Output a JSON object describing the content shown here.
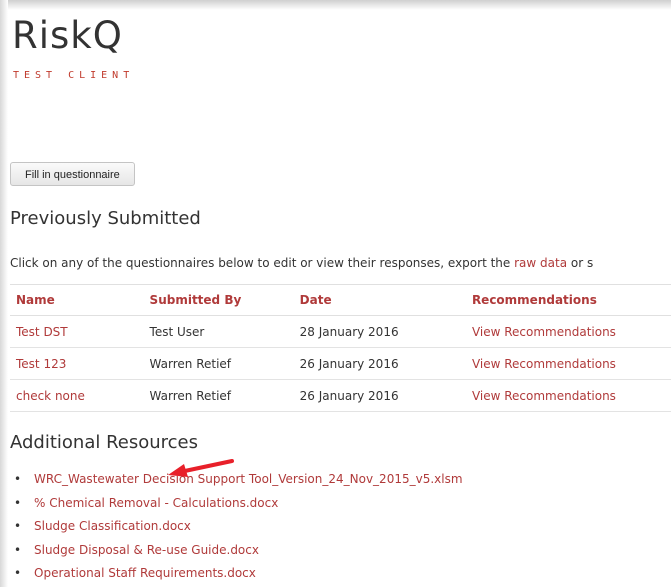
{
  "app": {
    "brand": "RiskQ",
    "client": "TEST CLIENT"
  },
  "actions": {
    "fill_button": "Fill in questionnaire"
  },
  "previous": {
    "heading": "Previously Submitted",
    "intro_prefix": "Click on any of the questionnaires below to edit or view their responses, export the ",
    "intro_link": "raw data",
    "intro_suffix": " or s",
    "columns": [
      "Name",
      "Submitted By",
      "Date",
      "Recommendations"
    ],
    "rows": [
      {
        "name": "Test DST",
        "submitted_by": "Test User",
        "date": "28 January 2016",
        "recommendations": "View Recommendations"
      },
      {
        "name": "Test 123",
        "submitted_by": "Warren Retief",
        "date": "26 January 2016",
        "recommendations": "View Recommendations"
      },
      {
        "name": "check none",
        "submitted_by": "Warren Retief",
        "date": "26 January 2016",
        "recommendations": "View Recommendations"
      }
    ]
  },
  "resources": {
    "heading": "Additional Resources",
    "items": [
      "WRC_Wastewater Decision Support Tool_Version_24_Nov_2015_v5.xlsm",
      "% Chemical Removal - Calculations.docx",
      "Sludge Classification.docx",
      "Sludge Disposal & Re-use Guide.docx",
      "Operational Staff Requirements.docx"
    ]
  },
  "colors": {
    "accent": "#b03a3a",
    "arrow": "#e8202a"
  },
  "icons": {
    "annotation": "red-arrow-icon"
  }
}
